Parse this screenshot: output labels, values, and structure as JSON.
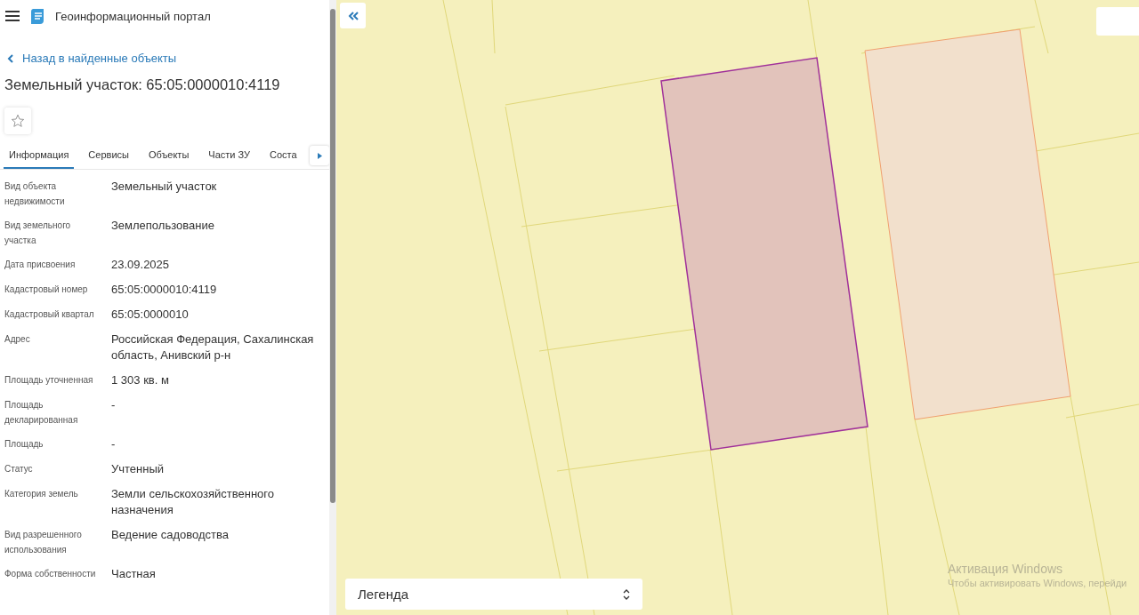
{
  "header": {
    "title": "Геоинформационный портал"
  },
  "back_link": "Назад в найденные объекты",
  "object_title": "Земельный участок: 65:05:0000010:4119",
  "favorite": {
    "selected": false
  },
  "tabs": [
    {
      "label": "Информация",
      "selected": true
    },
    {
      "label": "Сервисы",
      "selected": false
    },
    {
      "label": "Объекты",
      "selected": false
    },
    {
      "label": "Части ЗУ",
      "selected": false
    },
    {
      "label": "Соста",
      "selected": false
    }
  ],
  "properties": [
    {
      "label": "Вид объекта недвижимости",
      "value": "Земельный участок"
    },
    {
      "label": "Вид земельного участка",
      "value": "Землепользование"
    },
    {
      "label": "Дата присвоения",
      "value": "23.09.2025"
    },
    {
      "label": "Кадастровый номер",
      "value": "65:05:0000010:4119"
    },
    {
      "label": "Кадастровый квартал",
      "value": "65:05:0000010"
    },
    {
      "label": "Адрес",
      "value": "Российская Федерация, Сахалинская область, Анивский р-н"
    },
    {
      "label": "Площадь уточненная",
      "value": "1 303 кв. м"
    },
    {
      "label": "Площадь декларированная",
      "value": "-"
    },
    {
      "label": "Площадь",
      "value": "-"
    },
    {
      "label": "Статус",
      "value": "Учтенный"
    },
    {
      "label": "Категория земель",
      "value": "Земли сельскохозяйственного назначения"
    },
    {
      "label": "Вид разрешенного использования",
      "value": "Ведение садоводства"
    },
    {
      "label": "Форма собственности",
      "value": "Частная"
    }
  ],
  "legend": {
    "label": "Легенда"
  },
  "os_overlay": {
    "title": "Активация Windows",
    "text": "Чтобы активировать Windows, перейди"
  }
}
